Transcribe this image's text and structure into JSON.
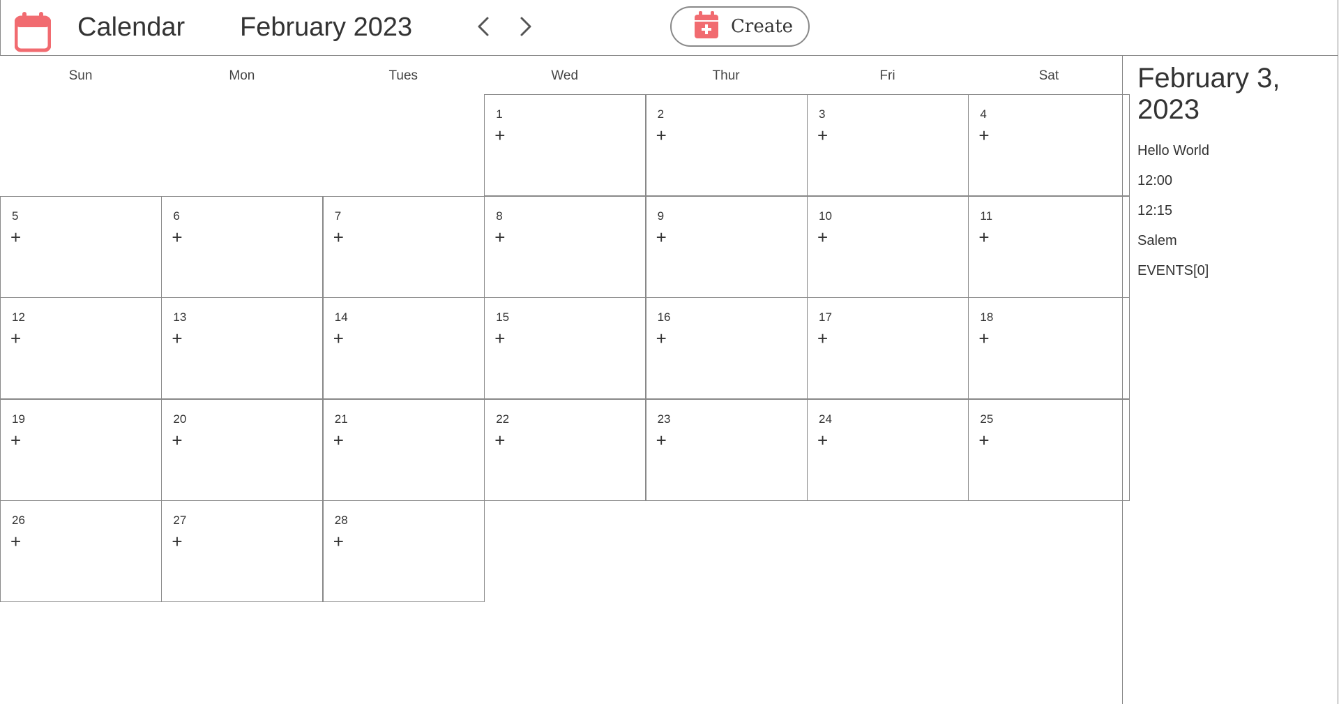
{
  "header": {
    "app_icon": "calendar-icon",
    "app_title": "Calendar",
    "month_title": "February 2023",
    "prev_icon": "chevron-left-icon",
    "next_icon": "chevron-right-icon",
    "create_icon": "calendar-plus-icon",
    "create_label": "Create"
  },
  "colors": {
    "accent": "#f16b70",
    "border": "#888888",
    "text": "#333333"
  },
  "calendar": {
    "weekdays": [
      "Sun",
      "Mon",
      "Tues",
      "Wed",
      "Thur",
      "Fri",
      "Sat"
    ],
    "start_weekday_index": 3,
    "days_in_month": 28,
    "add_symbol": "+"
  },
  "sidebar": {
    "date_title": "February 3, 2023",
    "event_title": "Hello World",
    "start_time": "12:00",
    "end_time": "12:15",
    "location": "Salem",
    "events_label": "EVENTS[0]"
  }
}
